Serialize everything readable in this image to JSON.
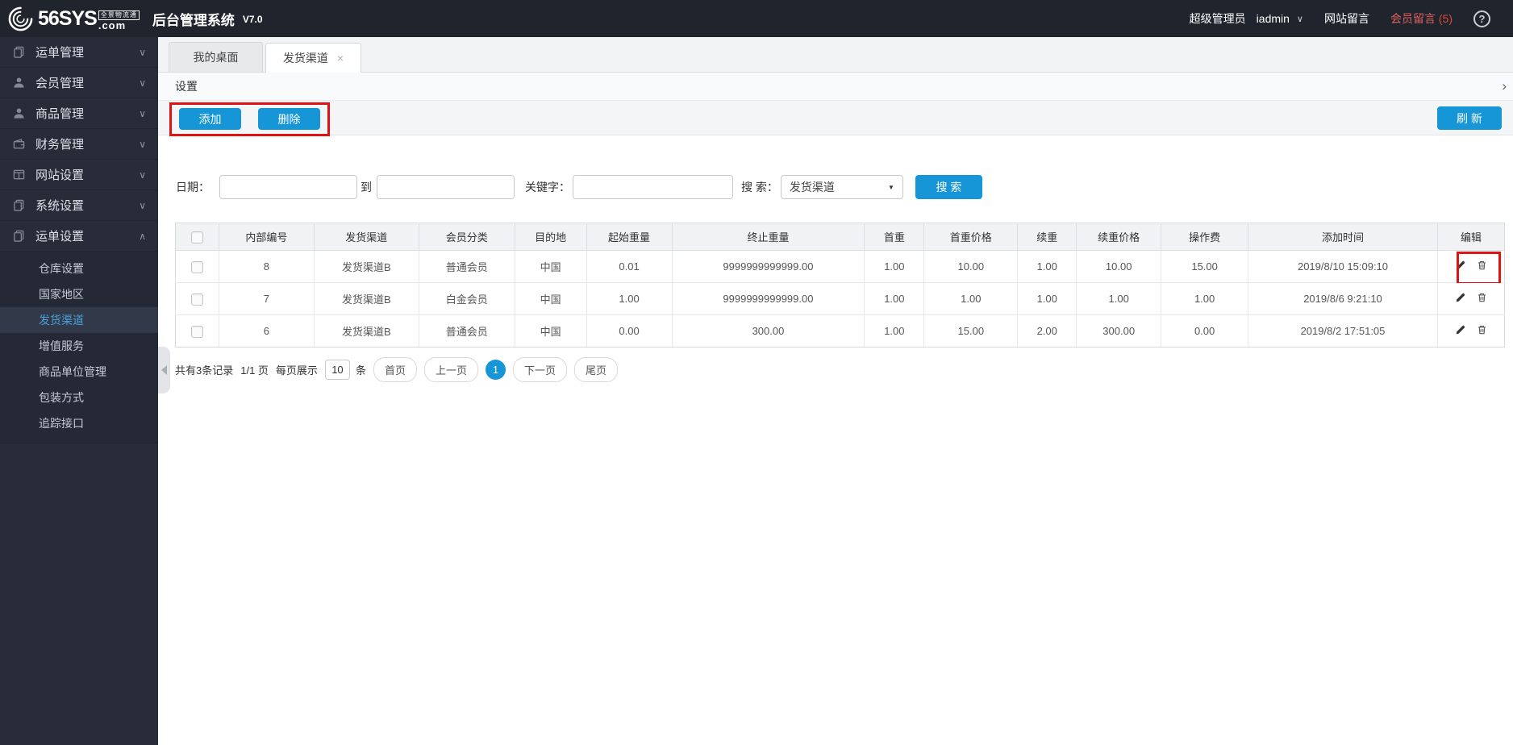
{
  "header": {
    "brand": "56SYS",
    "brand_tld": ".com",
    "brand_tagline": "全景物流通",
    "app_title": "后台管理系统",
    "version": "V7.0",
    "role": "超级管理员",
    "username": "iadmin",
    "site_messages": "网站留言",
    "member_messages": "会员留言",
    "member_badge": "(5)"
  },
  "icons": {
    "chevron_down": "∨",
    "chevron_up": "∧",
    "close": "×",
    "chevron_right": "›",
    "help": "?",
    "caret_down": "▼"
  },
  "sidebar": {
    "items": [
      {
        "label": "运单管理"
      },
      {
        "label": "会员管理"
      },
      {
        "label": "商品管理"
      },
      {
        "label": "财务管理"
      },
      {
        "label": "网站设置"
      },
      {
        "label": "系统设置"
      },
      {
        "label": "运单设置"
      }
    ],
    "submenu": [
      {
        "label": "仓库设置"
      },
      {
        "label": "国家地区"
      },
      {
        "label": "发货渠道"
      },
      {
        "label": "增值服务"
      },
      {
        "label": "商品单位管理"
      },
      {
        "label": "包装方式"
      },
      {
        "label": "追踪接口"
      }
    ]
  },
  "tabs": [
    {
      "label": "我的桌面"
    },
    {
      "label": "发货渠道"
    }
  ],
  "section_title": "设置",
  "toolbar": {
    "add": "添加",
    "delete": "删除",
    "refresh": "刷 新"
  },
  "filters": {
    "date_label": "日期：",
    "to_label": "到",
    "keyword_label": "关键字：",
    "search_label": "搜 索：",
    "search_type": "发货渠道",
    "search_button": "搜 索"
  },
  "table": {
    "columns": [
      "内部编号",
      "发货渠道",
      "会员分类",
      "目的地",
      "起始重量",
      "终止重量",
      "首重",
      "首重价格",
      "续重",
      "续重价格",
      "操作费",
      "添加时间",
      "编辑"
    ],
    "rows": [
      [
        "8",
        "发货渠道B",
        "普通会员",
        "中国",
        "0.01",
        "9999999999999.00",
        "1.00",
        "10.00",
        "1.00",
        "10.00",
        "15.00",
        "2019/8/10 15:09:10"
      ],
      [
        "7",
        "发货渠道B",
        "白金会员",
        "中国",
        "1.00",
        "9999999999999.00",
        "1.00",
        "1.00",
        "1.00",
        "1.00",
        "1.00",
        "2019/8/6 9:21:10"
      ],
      [
        "6",
        "发货渠道B",
        "普通会员",
        "中国",
        "0.00",
        "300.00",
        "1.00",
        "15.00",
        "2.00",
        "300.00",
        "0.00",
        "2019/8/2 17:51:05"
      ]
    ]
  },
  "pagination": {
    "summary": "共有3条记录",
    "page_info": "1/1 页",
    "per_page_label": "每页展示",
    "per_page": "10",
    "unit": "条",
    "first": "首页",
    "prev": "上一页",
    "current": "1",
    "next": "下一页",
    "last": "尾页"
  },
  "colors": {
    "accent": "#1696d7",
    "annotation": "#e01212",
    "badge": "#e0483f",
    "header_bg": "#20242c",
    "sidebar_bg": "#272c38"
  }
}
